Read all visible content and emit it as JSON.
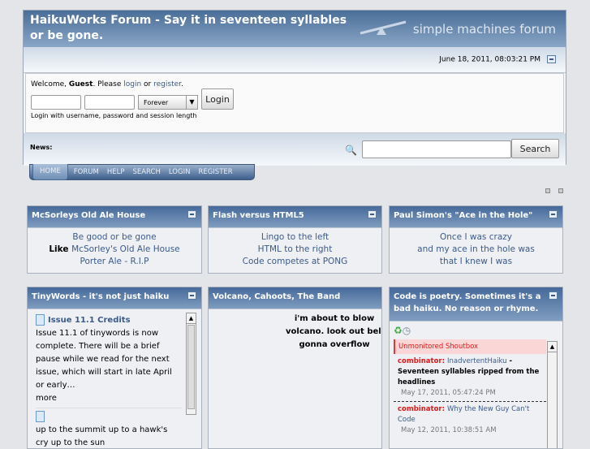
{
  "header": {
    "title": "HaikuWorks Forum - Say it in seventeen syllables or be gone.",
    "logo_text": "simple machines forum",
    "datetime": "June 18, 2011, 08:03:21 PM"
  },
  "login": {
    "welcome": "Welcome, ",
    "guest": "Guest",
    "please": ". Please ",
    "login_link": "login",
    "or": " or ",
    "register_link": "register",
    "end": ".",
    "session_option": "Forever",
    "login_button": "Login",
    "hint": "Login with username, password and session length"
  },
  "news": {
    "label": "News:",
    "search_button": "Search",
    "search_value": ""
  },
  "nav": [
    "HOME",
    "FORUM",
    "HELP",
    "SEARCH",
    "LOGIN",
    "REGISTER"
  ],
  "panels": [
    {
      "title": "McSorleys Old Ale House",
      "lines": [
        {
          "pre": "",
          "link": "Be good or be gone"
        },
        {
          "pre": "Like ",
          "link": "McSorley's Old Ale House"
        },
        {
          "pre": "",
          "link": "Porter Ale - R.I.P"
        }
      ]
    },
    {
      "title": "Flash versus HTML5",
      "lines": [
        {
          "pre": "",
          "link": "Lingo to the left"
        },
        {
          "pre": "",
          "link": "HTML to the right"
        },
        {
          "pre": "",
          "link": "Code competes at PONG"
        }
      ]
    },
    {
      "title": "Paul Simon's \"Ace in the Hole\"",
      "lines": [
        {
          "pre": "",
          "link": "Once I was crazy"
        },
        {
          "pre": "",
          "link": "and my ace in the hole was"
        },
        {
          "pre": "",
          "link": "that I knew I was"
        }
      ]
    }
  ],
  "tinywords": {
    "title": "TinyWords - it's not just haiku",
    "item1_title": "Issue 11.1 Credits",
    "item1_body": "Issue 11.1 of tinywords is now complete. There will be a brief pause while we read for the next issue, which will start in late April or early…",
    "item1_more": "more",
    "item2_body": "up to the summit up to a hawk's cry up to the sun"
  },
  "volcano": {
    "title": "Volcano, Cahoots, The Band",
    "lines": [
      "i'm about to blow",
      "volcano. look out below",
      "gonna overflow"
    ]
  },
  "shoutbox": {
    "title": "Code is poetry. Sometimes it's a bad haiku. No reason or rhyme.",
    "heading": "Unmonitored Shoutbox",
    "posts": [
      {
        "user": "combinator",
        "link": "InadvertentHaiku",
        "text": " - Seventeen syllables ripped from the headlines",
        "date": "May 17, 2011, 05:47:24 PM"
      },
      {
        "user": "combinator",
        "link": "Why the New Guy Can't Code",
        "text": "",
        "date": "May 12, 2011, 10:38:51 AM"
      }
    ]
  }
}
